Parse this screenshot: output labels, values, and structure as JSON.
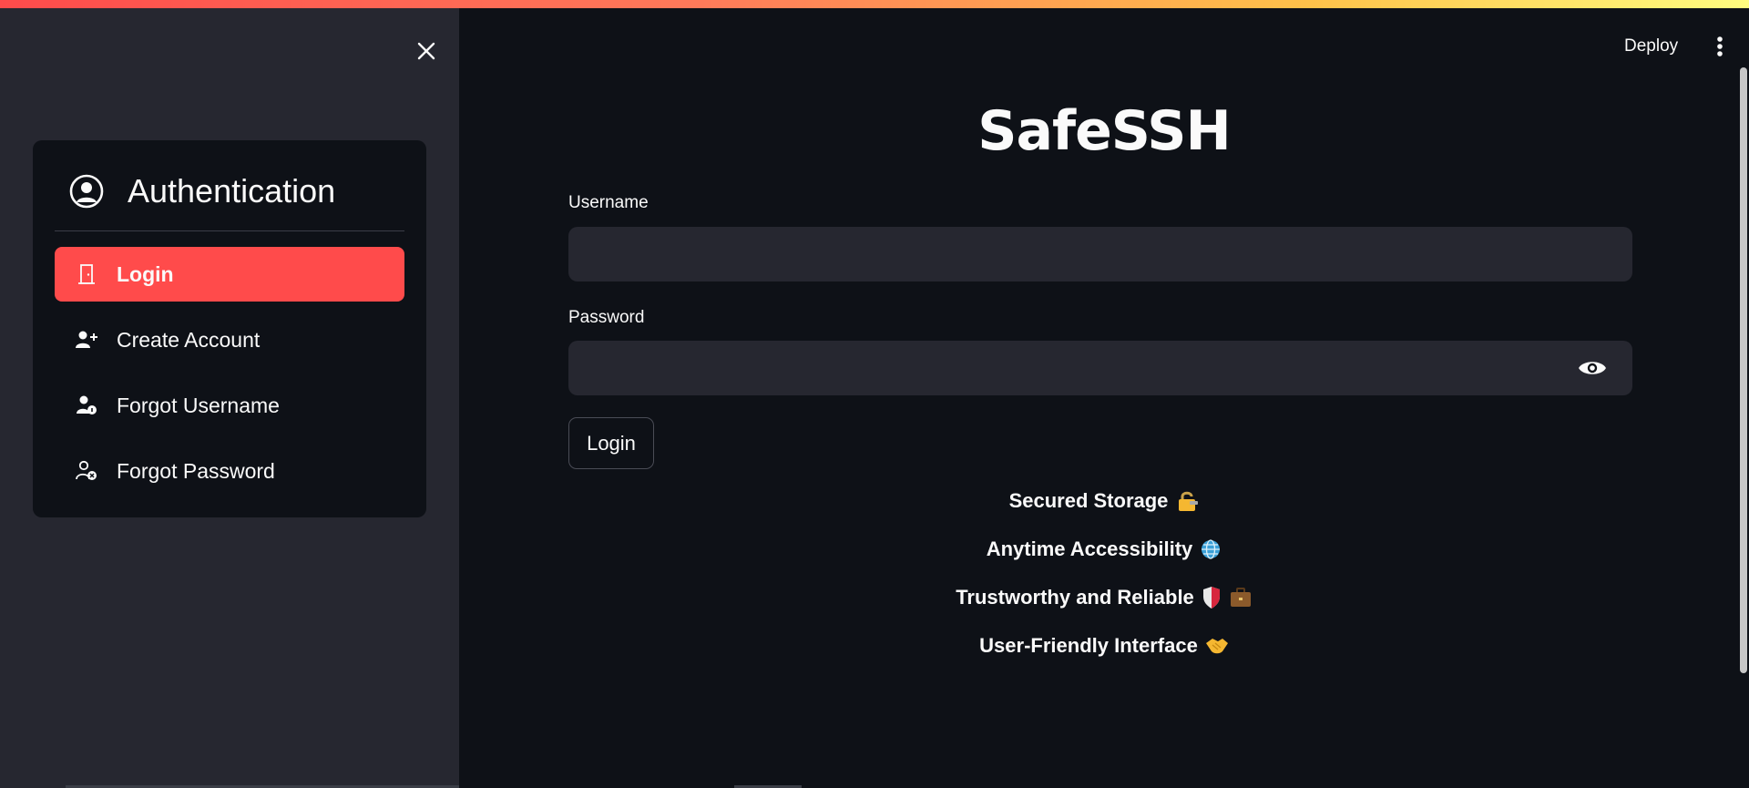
{
  "sidebar": {
    "menu_title": "Authentication",
    "items": [
      {
        "label": "Login",
        "icon": "door-icon",
        "active": true
      },
      {
        "label": "Create Account",
        "icon": "person-add-icon"
      },
      {
        "label": "Forgot Username",
        "icon": "person-info-icon"
      },
      {
        "label": "Forgot Password",
        "icon": "person-x-icon"
      }
    ]
  },
  "header": {
    "deploy_label": "Deploy"
  },
  "main": {
    "title": "SafeSSH",
    "username_label": "Username",
    "username_value": "",
    "password_label": "Password",
    "password_value": "",
    "login_button": "Login",
    "features": [
      {
        "text": "Secured Storage",
        "icons": [
          "lock-key-emoji"
        ]
      },
      {
        "text": "Anytime Accessibility",
        "icons": [
          "globe-emoji"
        ]
      },
      {
        "text": "Trustworthy and Reliable",
        "icons": [
          "shield-emoji",
          "briefcase-emoji"
        ]
      },
      {
        "text": "User-Friendly Interface",
        "icons": [
          "handshake-emoji"
        ]
      }
    ]
  },
  "colors": {
    "accent": "#ff4b4b",
    "background": "#0e1117",
    "sidebar": "#262730",
    "input": "#262730"
  }
}
